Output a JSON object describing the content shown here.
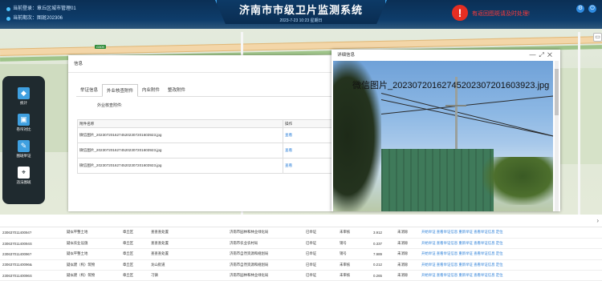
{
  "header": {
    "user_label": "当前登录：章丘区城市管理01",
    "period_label": "当前期次：图斑202306",
    "title": "济南市市级卫片监测系统",
    "datetime": "2023-7-23 10:23 星期日",
    "alert_text": "有返回图斑请及时处理!",
    "alert_icon": "!"
  },
  "map": {
    "road_sign": "G309"
  },
  "toolbar": {
    "items": [
      {
        "label": "统计",
        "icon": "cube-icon"
      },
      {
        "label": "卷帘对比",
        "icon": "image-compare-icon"
      },
      {
        "label": "图斑举证",
        "icon": "edit-icon"
      },
      {
        "label": "违法图斑",
        "icon": "location-icon"
      }
    ]
  },
  "info_panel": {
    "title": "信息",
    "tabs": [
      "举证信息",
      "外业核查附件",
      "内业附件",
      "整改附件"
    ],
    "active_tab": 1,
    "field_label": "外业核查附件:",
    "columns": [
      "附件名称",
      "操作"
    ],
    "rows": [
      {
        "name": "微信图片_20230720162745202307201603923.jpg",
        "op": "查看"
      },
      {
        "name": "微信图片_20230720162745202307201603923.jpg",
        "op": "查看"
      },
      {
        "name": "微信图片_20230720162745202307201603923.jpg",
        "op": "查看"
      }
    ]
  },
  "viewer": {
    "title": "详细信息",
    "controls": [
      "—",
      "⤢",
      "✕"
    ],
    "filename": "微信图片_20230720162745202307201603923.jpg"
  },
  "bottom_table": {
    "rows": [
      [
        "23063701140094?",
        "疑似平整土地",
        "章丘区",
        "查查查处置",
        "济南市园林和林业绿化局",
        "已举证",
        "未审核",
        "3.912",
        "未消除",
        "开始举证 查看举证信息 重新举证 查看举证信息 定位"
      ],
      [
        "23063701140094S",
        "疑似农业设施",
        "章丘区",
        "查查查处置",
        "济南市农业农村局",
        "已举证",
        "销号",
        "0.337",
        "未消除",
        "开始举证 查看举证信息 重新举证 查看举证信息 定位"
      ],
      [
        "23063701140096?",
        "疑似平整土地",
        "章丘区",
        "查查查处置",
        "济南市自然资源和规划局",
        "已举证",
        "销号",
        "7.989",
        "未消除",
        "开始举证 查看举证信息 重新举证 查看举证信息 定位"
      ],
      [
        "23063701140096&",
        "疑似建（构）筑物",
        "章丘区",
        "龙山街道",
        "济南市自然资源和规划局",
        "已举证",
        "未审核",
        "0.212",
        "未消除",
        "开始举证 查看举证信息 重新举证 查看举证信息 定位"
      ],
      [
        "23063701140096S",
        "疑似建（构）筑物",
        "章丘区",
        "刁镇",
        "济南市园林和林业绿化局",
        "已举证",
        "未审核",
        "0.265",
        "未消除",
        "开始举证 查看举证信息 重新举证 查看举证信息 定位"
      ]
    ]
  },
  "colors": {
    "header_bg": "#0b2f55",
    "title_accent": "#3aa0e8",
    "alert": "#e52e22",
    "link": "#2b7fd8"
  }
}
